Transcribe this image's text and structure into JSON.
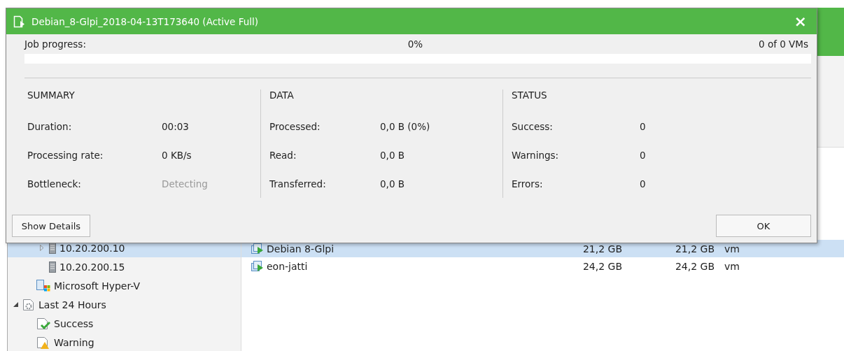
{
  "dialog": {
    "title": "Debian_8-Glpi_2018-04-13T173640 (Active Full)",
    "close": "×",
    "progress": {
      "label": "Job progress:",
      "percent": "0%",
      "count": "0 of 0 VMs",
      "level": 0
    },
    "sections": [
      {
        "heading": "SUMMARY",
        "rows": [
          {
            "label": "Duration:",
            "value": "00:03",
            "dim": false
          },
          {
            "label": "Processing rate:",
            "value": "0 KB/s",
            "dim": false
          },
          {
            "label": "Bottleneck:",
            "value": "Detecting",
            "dim": true
          }
        ]
      },
      {
        "heading": "DATA",
        "rows": [
          {
            "label": "Processed:",
            "value": "0,0 B (0%)",
            "dim": false
          },
          {
            "label": "Read:",
            "value": "0,0 B",
            "dim": false
          },
          {
            "label": "Transferred:",
            "value": "0,0 B",
            "dim": false
          }
        ]
      },
      {
        "heading": "STATUS",
        "rows": [
          {
            "label": "Success:",
            "value": "0",
            "dim": false
          },
          {
            "label": "Warnings:",
            "value": "0",
            "dim": false
          },
          {
            "label": "Errors:",
            "value": "0",
            "dim": false
          }
        ]
      }
    ],
    "buttons": [
      "Show Details",
      "OK"
    ]
  },
  "tree": [
    {
      "kind": "server",
      "label": "10.20.200.10",
      "expanded": false,
      "selected": true
    },
    {
      "kind": "server",
      "label": "10.20.200.15",
      "selected": false
    },
    {
      "kind": "hyperv",
      "label": "Microsoft Hyper-V",
      "selected": false
    },
    {
      "kind": "period",
      "label": "Last 24 Hours",
      "expanded": true,
      "selected": false,
      "children": [
        {
          "kind": "success",
          "label": "Success",
          "selected": false
        },
        {
          "kind": "warning",
          "label": "Warning",
          "selected": false
        }
      ]
    }
  ],
  "list": [
    {
      "name": "Debian 8-Glpi",
      "column_2": "21,2 GB",
      "column_3": "21,2 GB",
      "column_4": "vm",
      "selected": true
    },
    {
      "name": "eon-jatti",
      "column_2": "24,2 GB",
      "column_3": "24,2 GB",
      "column_4": "vm",
      "selected": false
    }
  ]
}
